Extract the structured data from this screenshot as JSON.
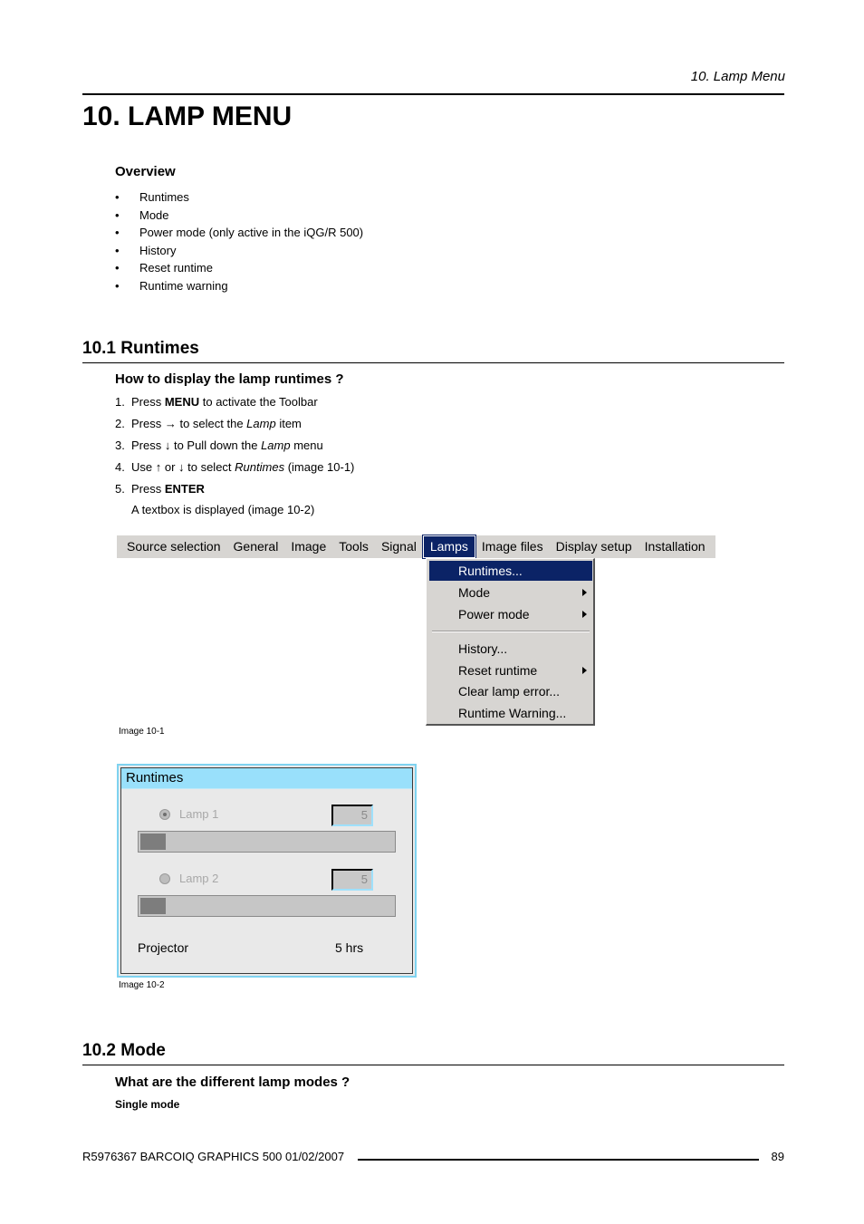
{
  "header": {
    "running_title": "10.  Lamp Menu",
    "chapter_title": "10. LAMP MENU"
  },
  "overview": {
    "title": "Overview",
    "bullet_char": "•",
    "items": [
      "Runtimes",
      "Mode",
      "Power mode (only active in the iQG/R 500)",
      "History",
      "Reset runtime",
      "Runtime warning"
    ]
  },
  "section_10_1": {
    "title": "10.1  Runtimes",
    "subtitle": "How to display the lamp runtimes ?",
    "steps": [
      {
        "num": "1.",
        "pre": "Press ",
        "bold": "MENU",
        "italic": "",
        "post": " to activate the Toolbar"
      },
      {
        "num": "2.",
        "pre": "Press → to select the ",
        "bold": "",
        "italic": "Lamp",
        "post": " item"
      },
      {
        "num": "3.",
        "pre": "Press ↓ to Pull down the ",
        "bold": "",
        "italic": "Lamp",
        "post": " menu"
      },
      {
        "num": "4.",
        "pre": "Use ↑ or ↓ to select ",
        "bold": "",
        "italic": "Runtimes",
        "post": " (image 10-1)"
      },
      {
        "num": "5.",
        "pre": "Press ",
        "bold": "ENTER",
        "italic": "",
        "post": ""
      }
    ],
    "step_note": "A textbox is displayed (image 10-2)"
  },
  "image_10_1": {
    "caption": "Image 10-1",
    "toolbar_items": [
      "Source selection",
      "General",
      "Image",
      "Tools",
      "Signal",
      "Lamps",
      "Image files",
      "Display setup",
      "Installation"
    ],
    "active_toolbar_item": "Lamps",
    "menu_items": [
      {
        "label": "Runtimes...",
        "submenu": false,
        "selected": true
      },
      {
        "label": "Mode",
        "submenu": true,
        "selected": false
      },
      {
        "label": "Power mode",
        "submenu": true,
        "selected": false
      },
      {
        "label": "History...",
        "submenu": false,
        "selected": false
      },
      {
        "label": "Reset runtime",
        "submenu": true,
        "selected": false
      },
      {
        "label": "Clear lamp error...",
        "submenu": false,
        "selected": false
      },
      {
        "label": "Runtime Warning...",
        "submenu": false,
        "selected": false
      }
    ],
    "colors": {
      "toolbar_bg": "#d7d5d2",
      "highlight": "#0b2366"
    }
  },
  "image_10_2": {
    "caption": "Image 10-2",
    "dialog_title": "Runtimes",
    "lamps": [
      {
        "label": "Lamp 1",
        "value": "5",
        "selected": true,
        "progress": 0.05
      },
      {
        "label": "Lamp 2",
        "value": "5",
        "selected": false,
        "progress": 0.05
      }
    ],
    "projector_label": "Projector",
    "projector_value": "5 hrs",
    "colors": {
      "title_bg": "#99e0fb",
      "border": "#7fd3f0"
    }
  },
  "section_10_2": {
    "title": "10.2  Mode",
    "subtitle": "What are the different lamp modes ?",
    "minor_heading": "Single mode"
  },
  "footer": {
    "text": "R5976367   BARCOIQ GRAPHICS 500   01/02/2007",
    "page_number": "89"
  }
}
